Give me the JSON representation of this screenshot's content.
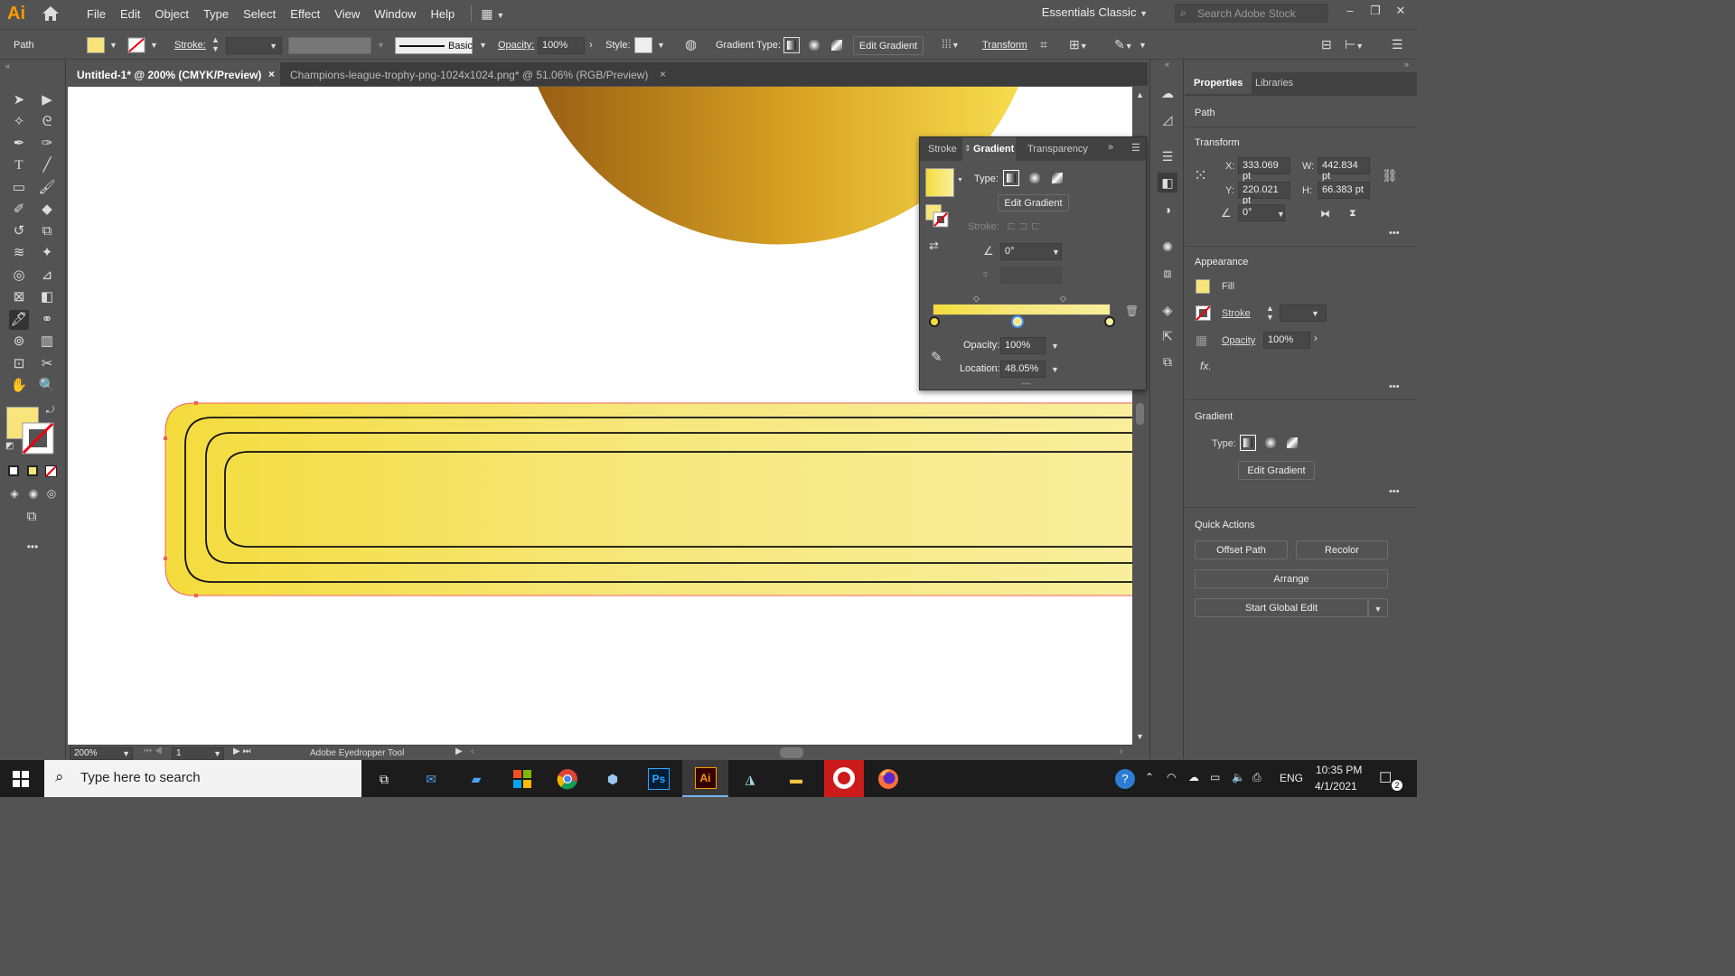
{
  "app": {
    "logo": "Ai",
    "menu": [
      "File",
      "Edit",
      "Object",
      "Type",
      "Select",
      "Effect",
      "View",
      "Window",
      "Help"
    ],
    "workspace": "Essentials Classic",
    "stock_search_placeholder": "Search Adobe Stock"
  },
  "control_bar": {
    "selection_type": "Path",
    "stroke_label": "Stroke:",
    "brush_label": "Basic",
    "opacity_label": "Opacity:",
    "opacity_value": "100%",
    "style_label": "Style:",
    "gradient_type_label": "Gradient Type:",
    "edit_gradient": "Edit Gradient",
    "transform": "Transform"
  },
  "doc_tabs": [
    {
      "label": "Untitled-1* @ 200% (CMYK/Preview)",
      "close": "×",
      "active": true
    },
    {
      "label": "Champions-league-trophy-png-1024x1024.png* @ 51.06% (RGB/Preview)",
      "close": "×",
      "active": false
    }
  ],
  "status_bar": {
    "zoom": "200%",
    "artboard": "1",
    "tool_name": "Adobe Eyedropper Tool"
  },
  "gradient_panel": {
    "tabs": [
      "Stroke",
      "Gradient",
      "Transparency"
    ],
    "type_label": "Type:",
    "edit_gradient": "Edit Gradient",
    "stroke_label": "Stroke:",
    "angle": "0°",
    "opacity_label": "Opacity:",
    "opacity_value": "100%",
    "location_label": "Location:",
    "location_value": "48.05%",
    "stops": [
      0.0,
      0.4805,
      1.0
    ],
    "colors": {
      "start": "#f4dc3c",
      "end": "#f8ef9e"
    }
  },
  "properties": {
    "tabs": [
      "Properties",
      "Libraries"
    ],
    "object": "Path",
    "transform_title": "Transform",
    "x_label": "X:",
    "x": "333.069 pt",
    "y_label": "Y:",
    "y": "220.021 pt",
    "w_label": "W:",
    "w": "442.834 pt",
    "h_label": "H:",
    "h": "66.383 pt",
    "angle": "0°",
    "appearance_title": "Appearance",
    "fill_label": "Fill",
    "stroke_label": "Stroke",
    "opacity_label": "Opacity",
    "opacity_value": "100%",
    "fx": "fx.",
    "gradient_title": "Gradient",
    "type_label": "Type:",
    "edit_gradient": "Edit Gradient",
    "quick_actions_title": "Quick Actions",
    "offset_path": "Offset Path",
    "recolor": "Recolor",
    "arrange": "Arrange",
    "start_global_edit": "Start Global Edit",
    "more": "•••"
  },
  "taskbar": {
    "search_placeholder": "Type here to search",
    "lang": "ENG",
    "time": "10:35 PM",
    "date": "4/1/2021",
    "notifications": "2"
  }
}
